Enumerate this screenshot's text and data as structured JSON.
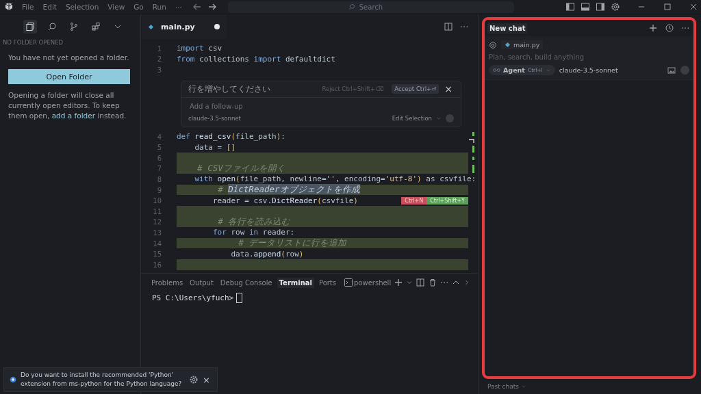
{
  "menu": [
    "File",
    "Edit",
    "Selection",
    "View",
    "Go",
    "Run",
    "···"
  ],
  "search": {
    "placeholder": "Search"
  },
  "sidebar": {
    "section": "NO FOLDER OPENED",
    "message": "You have not yet opened a folder.",
    "button": "Open Folder",
    "note_before": "Opening a folder will close all currently open editors. To keep them open,",
    "note_link": "add a folder",
    "note_after": "instead."
  },
  "editor_tabs": [
    {
      "label": "main.py",
      "selected": true,
      "modified": true
    }
  ],
  "code_top": [
    {
      "num": "1",
      "added": false,
      "tokens": [
        {
          "t": "import",
          "kind": "kw"
        },
        {
          "t": " csv",
          "kind": "var"
        }
      ]
    },
    {
      "num": "2",
      "added": false,
      "tokens": [
        {
          "t": "from",
          "kind": "kw"
        },
        {
          "t": " collections ",
          "kind": "var"
        },
        {
          "t": "import",
          "kind": "kw"
        },
        {
          "t": " defaultdict",
          "kind": "var"
        }
      ]
    },
    {
      "num": "3",
      "added": false
    }
  ],
  "inline_edit": {
    "prompt": "行を増やしてください",
    "reject": "Reject Ctrl+Shift+⌫",
    "accept": "Accept Ctrl+⏎",
    "close": "×",
    "placeholder": "Add a follow-up",
    "model": "claude-3.5-sonnet",
    "mode": "Edit Selection"
  },
  "code_bottom": [
    {
      "num": "4",
      "added": false,
      "tokens": [
        {
          "t": "def ",
          "kind": "kw"
        },
        {
          "t": "read_csv",
          "kind": "fn"
        },
        {
          "t": "(",
          "kind": "paren"
        },
        {
          "t": "file_path",
          "kind": "var"
        },
        {
          "t": ")",
          "kind": "paren"
        },
        {
          "t": ":",
          "kind": "var"
        }
      ]
    },
    {
      "num": "5",
      "added": false,
      "tokens": [
        {
          "t": "    data = ",
          "kind": "var"
        },
        {
          "t": "[]",
          "kind": "paren"
        }
      ]
    },
    {
      "num": "6",
      "added": true
    },
    {
      "num": "7",
      "added": true,
      "tokens": [
        {
          "t": "    # CSVファイルを開く",
          "kind": "cm"
        }
      ]
    },
    {
      "num": "8",
      "added": false,
      "tokens": [
        {
          "t": "    with ",
          "kind": "kw"
        },
        {
          "t": "open",
          "kind": "fn"
        },
        {
          "t": "(",
          "kind": "paren"
        },
        {
          "t": "file_path, newline=",
          "kind": "var"
        },
        {
          "t": "''",
          "kind": "str"
        },
        {
          "t": ", encoding=",
          "kind": "var"
        },
        {
          "t": "'utf-8'",
          "kind": "str"
        },
        {
          "t": ")",
          "kind": "paren"
        },
        {
          "t": " as csvfile:",
          "kind": "var"
        }
      ]
    },
    {
      "num": "9",
      "added": true,
      "tokens": [
        {
          "t": "        # ",
          "kind": "cm"
        },
        {
          "t": "DictReaderオブジェクトを作成",
          "kind": "sel"
        }
      ]
    },
    {
      "num": "10",
      "added": false,
      "tokens": [
        {
          "t": "        reader = csv.",
          "kind": "var"
        },
        {
          "t": "DictReader",
          "kind": "fn"
        },
        {
          "t": "(",
          "kind": "paren"
        },
        {
          "t": "csvfile",
          "kind": "var"
        },
        {
          "t": ")",
          "kind": "paren"
        }
      ],
      "reject": "Ctrl+N",
      "accept": "Ctrl+Shift+Y"
    },
    {
      "num": "11",
      "added": true
    },
    {
      "num": "12",
      "added": true,
      "tokens": [
        {
          "t": "        # 各行を読み込む",
          "kind": "cm"
        }
      ]
    },
    {
      "num": "13",
      "added": false,
      "tokens": [
        {
          "t": "        for ",
          "kind": "kw"
        },
        {
          "t": "row ",
          "kind": "var"
        },
        {
          "t": "in ",
          "kind": "kw"
        },
        {
          "t": "reader:",
          "kind": "var"
        }
      ]
    },
    {
      "num": "14",
      "added": true,
      "tokens": [
        {
          "t": "            # データリストに行を追加",
          "kind": "cm"
        }
      ]
    },
    {
      "num": "15",
      "added": false,
      "tokens": [
        {
          "t": "            data.",
          "kind": "var"
        },
        {
          "t": "append",
          "kind": "fn"
        },
        {
          "t": "(",
          "kind": "paren"
        },
        {
          "t": "row",
          "kind": "var"
        },
        {
          "t": ")",
          "kind": "paren"
        }
      ]
    },
    {
      "num": "16",
      "added": true
    }
  ],
  "panel_tabs": [
    {
      "label": "Problems",
      "selected": false
    },
    {
      "label": "Output",
      "selected": false
    },
    {
      "label": "Debug Console",
      "selected": false
    },
    {
      "label": "Terminal",
      "selected": true
    },
    {
      "label": "Ports",
      "selected": false
    }
  ],
  "terminal": {
    "shell": "powershell",
    "prompt": "PS C:\\Users\\yfuch>"
  },
  "notification": {
    "text": "Do you want to install the recommended 'Python' extension from ms-python for the Python language?",
    "close": "×"
  },
  "chat": {
    "title": "New chat",
    "context_file": "main.py",
    "placeholder": "Plan, search, build anything",
    "mode": "Agent",
    "mode_shortcut": "Ctrl+I",
    "model": "claude-3.5-sonnet",
    "past_chats": "Past chats"
  }
}
